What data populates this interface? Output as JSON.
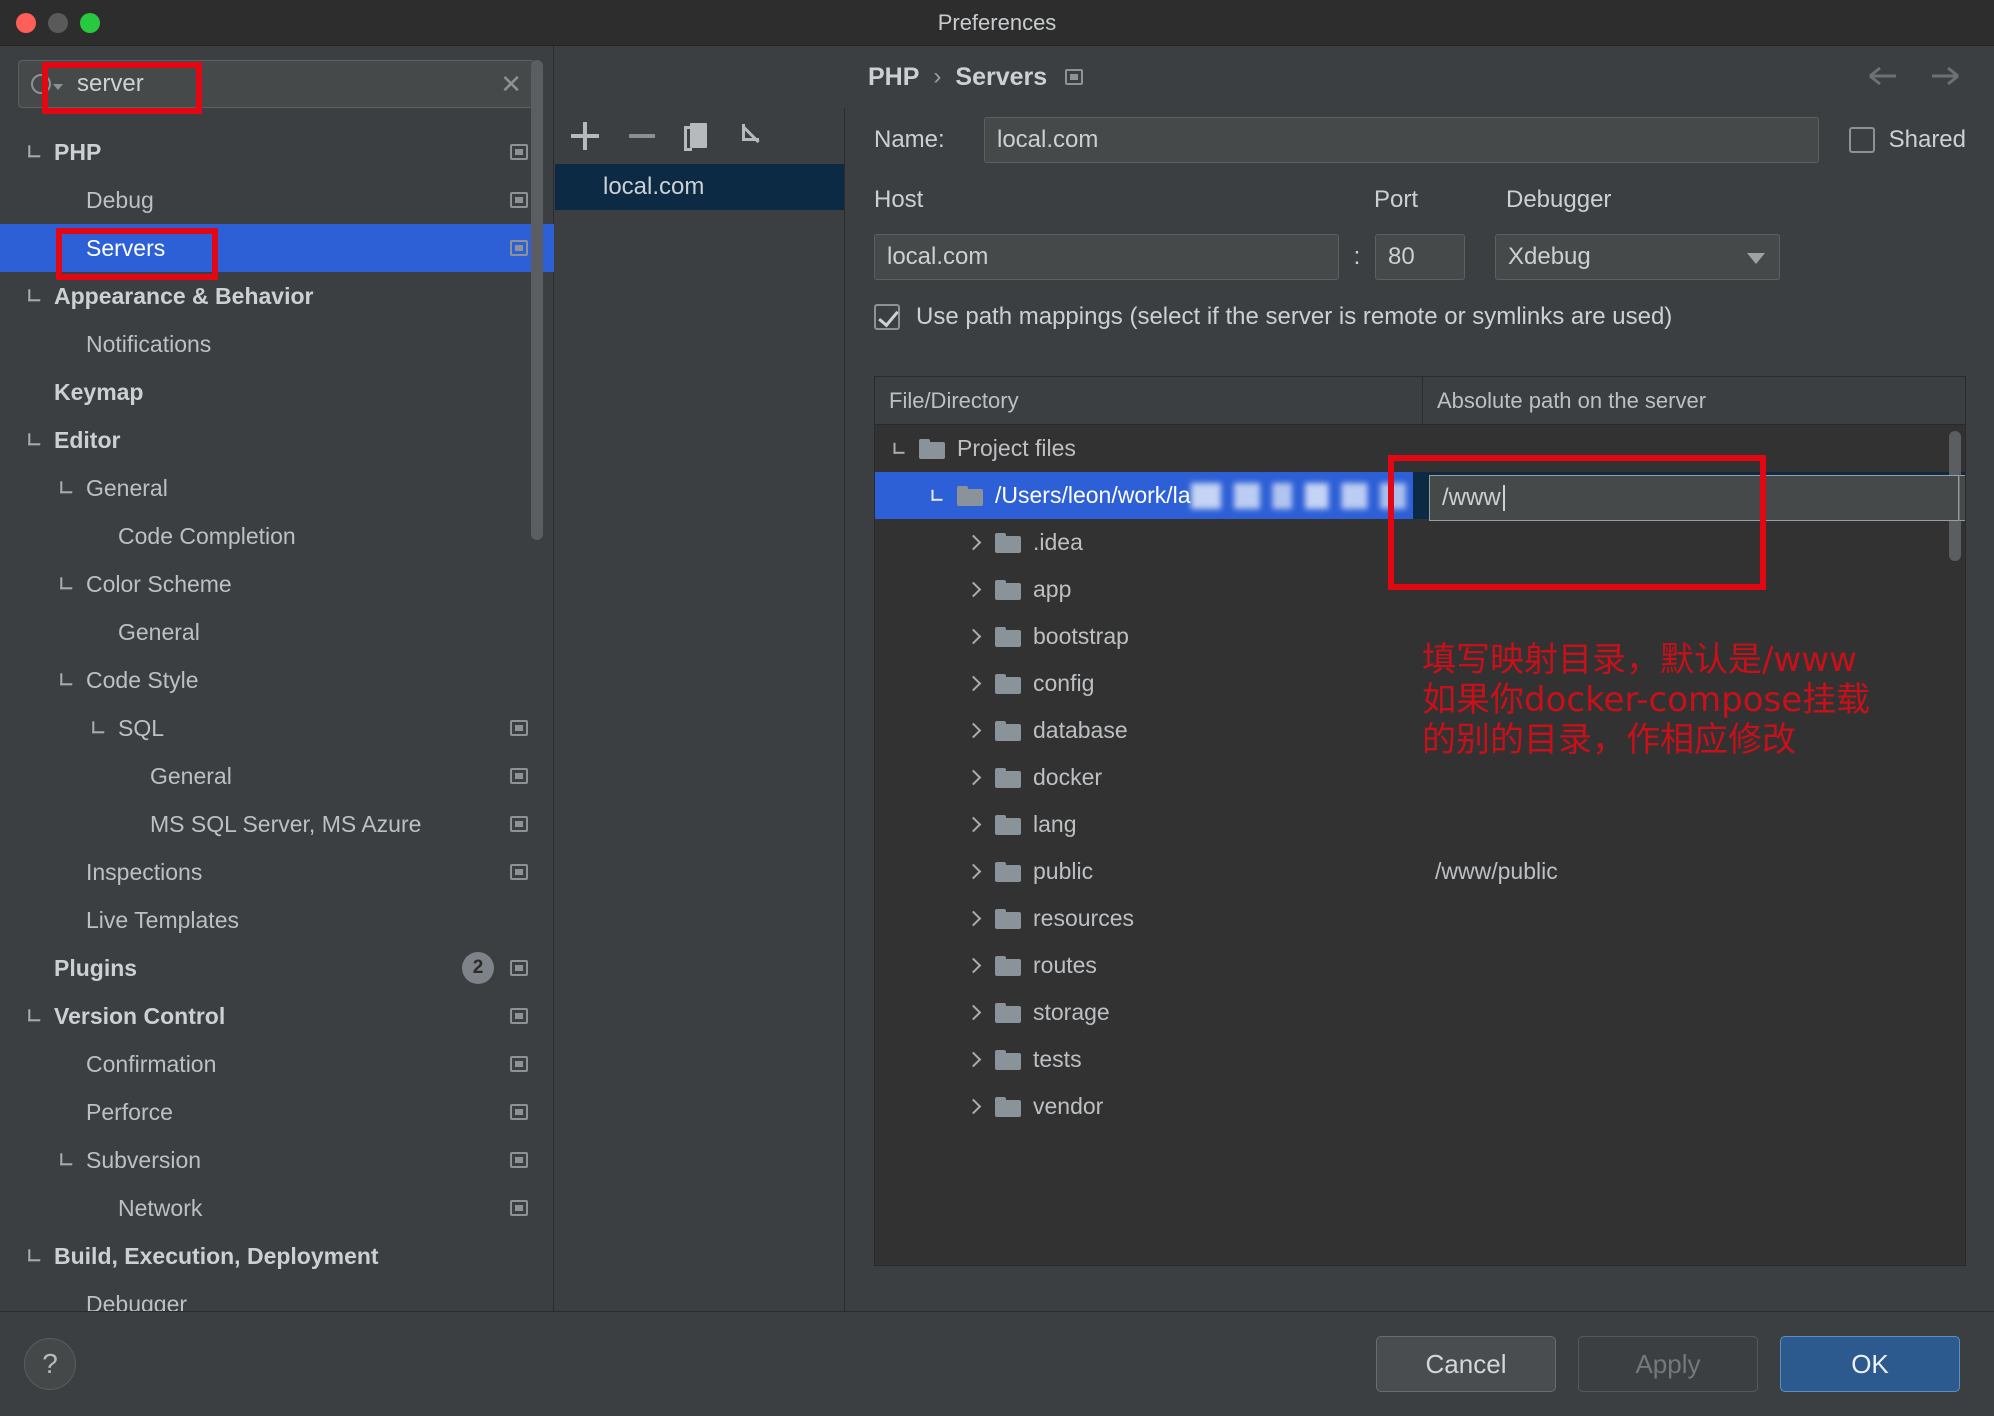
{
  "window": {
    "title": "Preferences"
  },
  "search": {
    "value": "server",
    "clear_icon": "close-icon",
    "search_icon": "search-icon"
  },
  "sidebar": {
    "items": [
      {
        "label": "PHP",
        "level": 0,
        "bold": true,
        "expandable": true,
        "config": true,
        "selected": false
      },
      {
        "label": "Debug",
        "level": 1,
        "bold": false,
        "expandable": false,
        "config": true,
        "selected": false
      },
      {
        "label": "Servers",
        "level": 1,
        "bold": false,
        "expandable": false,
        "config": true,
        "selected": true
      },
      {
        "label": "Appearance & Behavior",
        "level": 0,
        "bold": true,
        "expandable": true,
        "config": false,
        "selected": false
      },
      {
        "label": "Notifications",
        "level": 1,
        "bold": false,
        "expandable": false,
        "config": false,
        "selected": false
      },
      {
        "label": "Keymap",
        "level": 0,
        "bold": true,
        "expandable": false,
        "config": false,
        "selected": false
      },
      {
        "label": "Editor",
        "level": 0,
        "bold": true,
        "expandable": true,
        "config": false,
        "selected": false
      },
      {
        "label": "General",
        "level": 1,
        "bold": false,
        "expandable": true,
        "config": false,
        "selected": false
      },
      {
        "label": "Code Completion",
        "level": 2,
        "bold": false,
        "expandable": false,
        "config": false,
        "selected": false
      },
      {
        "label": "Color Scheme",
        "level": 1,
        "bold": false,
        "expandable": true,
        "config": false,
        "selected": false
      },
      {
        "label": "General",
        "level": 2,
        "bold": false,
        "expandable": false,
        "config": false,
        "selected": false
      },
      {
        "label": "Code Style",
        "level": 1,
        "bold": false,
        "expandable": true,
        "config": false,
        "selected": false
      },
      {
        "label": "SQL",
        "level": 2,
        "bold": false,
        "expandable": true,
        "config": true,
        "selected": false
      },
      {
        "label": "General",
        "level": 3,
        "bold": false,
        "expandable": false,
        "config": true,
        "selected": false
      },
      {
        "label": "MS SQL Server, MS Azure",
        "level": 3,
        "bold": false,
        "expandable": false,
        "config": true,
        "selected": false
      },
      {
        "label": "Inspections",
        "level": 1,
        "bold": false,
        "expandable": false,
        "config": true,
        "selected": false
      },
      {
        "label": "Live Templates",
        "level": 1,
        "bold": false,
        "expandable": false,
        "config": false,
        "selected": false
      },
      {
        "label": "Plugins",
        "level": 0,
        "bold": true,
        "expandable": false,
        "config": true,
        "badge": "2",
        "selected": false
      },
      {
        "label": "Version Control",
        "level": 0,
        "bold": true,
        "expandable": true,
        "config": true,
        "selected": false
      },
      {
        "label": "Confirmation",
        "level": 1,
        "bold": false,
        "expandable": false,
        "config": true,
        "selected": false
      },
      {
        "label": "Perforce",
        "level": 1,
        "bold": false,
        "expandable": false,
        "config": true,
        "selected": false
      },
      {
        "label": "Subversion",
        "level": 1,
        "bold": false,
        "expandable": true,
        "config": true,
        "selected": false
      },
      {
        "label": "Network",
        "level": 2,
        "bold": false,
        "expandable": false,
        "config": true,
        "selected": false
      },
      {
        "label": "Build, Execution, Deployment",
        "level": 0,
        "bold": true,
        "expandable": true,
        "config": false,
        "selected": false
      },
      {
        "label": "Debugger",
        "level": 1,
        "bold": false,
        "expandable": false,
        "config": false,
        "selected": false
      }
    ]
  },
  "middle_pane": {
    "toolbar": [
      {
        "name": "add-server-button",
        "icon": "plus-icon"
      },
      {
        "name": "remove-server-button",
        "icon": "minus-icon"
      },
      {
        "name": "copy-server-button",
        "icon": "copy-icon"
      },
      {
        "name": "import-server-button",
        "icon": "import-icon"
      }
    ],
    "servers": [
      {
        "label": "local.com",
        "selected": true
      }
    ]
  },
  "breadcrumb": {
    "root": "PHP",
    "separator": "›",
    "current": "Servers",
    "config_icon": "settings-icon"
  },
  "nav": {
    "back_icon": "arrow-left-icon",
    "forward_icon": "arrow-right-icon"
  },
  "form": {
    "name_label": "Name:",
    "name_value": "local.com",
    "shared_label": "Shared",
    "shared_checked": false,
    "host_label": "Host",
    "host_value": "local.com",
    "colon": ":",
    "port_label": "Port",
    "port_value": "80",
    "debugger_label": "Debugger",
    "debugger_value": "Xdebug",
    "path_mappings_label": "Use path mappings (select if the server is remote or symlinks are used)",
    "path_mappings_checked": true
  },
  "mapping_table": {
    "headers": [
      "File/Directory",
      "Absolute path on the server"
    ],
    "rows": [
      {
        "label": "Project files",
        "indent": 0,
        "expanded": true,
        "has_folder": true,
        "mapped": "",
        "selected": false
      },
      {
        "label": "/Users/leon/work/la",
        "label_redacted": true,
        "indent": 1,
        "expanded": true,
        "has_folder": true,
        "mapped": "",
        "selected": true
      },
      {
        "label": ".idea",
        "indent": 2,
        "expanded": false,
        "has_folder": true,
        "mapped": "",
        "selected": false
      },
      {
        "label": "app",
        "indent": 2,
        "expanded": false,
        "has_folder": true,
        "mapped": "",
        "selected": false
      },
      {
        "label": "bootstrap",
        "indent": 2,
        "expanded": false,
        "has_folder": true,
        "mapped": "",
        "selected": false
      },
      {
        "label": "config",
        "indent": 2,
        "expanded": false,
        "has_folder": true,
        "mapped": "",
        "selected": false
      },
      {
        "label": "database",
        "indent": 2,
        "expanded": false,
        "has_folder": true,
        "mapped": "",
        "selected": false
      },
      {
        "label": "docker",
        "indent": 2,
        "expanded": false,
        "has_folder": true,
        "mapped": "",
        "selected": false
      },
      {
        "label": "lang",
        "indent": 2,
        "expanded": false,
        "has_folder": true,
        "mapped": "",
        "selected": false
      },
      {
        "label": "public",
        "indent": 2,
        "expanded": false,
        "has_folder": true,
        "mapped": "/www/public",
        "selected": false
      },
      {
        "label": "resources",
        "indent": 2,
        "expanded": false,
        "has_folder": true,
        "mapped": "",
        "selected": false
      },
      {
        "label": "routes",
        "indent": 2,
        "expanded": false,
        "has_folder": true,
        "mapped": "",
        "selected": false
      },
      {
        "label": "storage",
        "indent": 2,
        "expanded": false,
        "has_folder": true,
        "mapped": "",
        "selected": false
      },
      {
        "label": "tests",
        "indent": 2,
        "expanded": false,
        "has_folder": true,
        "mapped": "",
        "selected": false
      },
      {
        "label": "vendor",
        "indent": 2,
        "expanded": false,
        "has_folder": true,
        "mapped": "",
        "selected": false
      }
    ],
    "editing_cell_value": "/www"
  },
  "annotation": {
    "color": "#c8101a",
    "line1": "填写映射目录，默认是/www",
    "line2": "如果你docker-compose挂载",
    "line3": "的别的目录，作相应修改"
  },
  "footer": {
    "help_icon": "question-mark-icon",
    "cancel_label": "Cancel",
    "apply_label": "Apply",
    "ok_label": "OK"
  }
}
